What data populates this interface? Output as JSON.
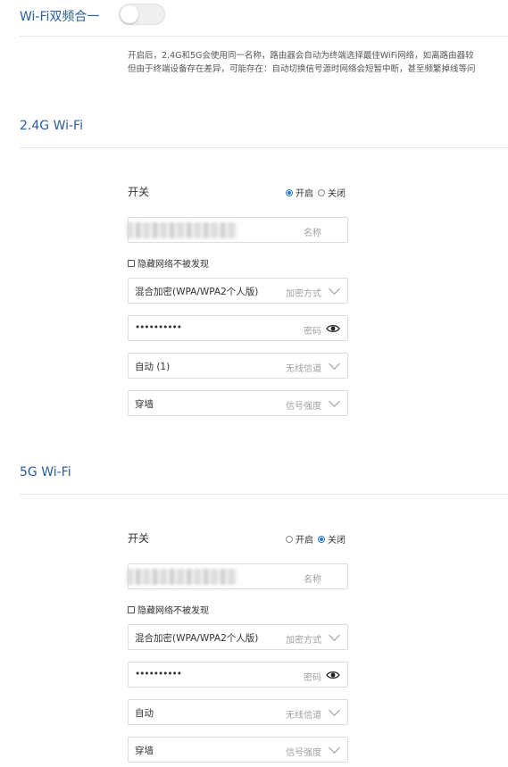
{
  "dual_band": {
    "title": "Wi-Fi双频合一",
    "enabled": false,
    "description_line1": "开启后，2.4G和5G会使用同一名称，路由器会自动为终端选择最佳WiFi网络，如离路由器较",
    "description_line2": "但由于终端设备存在差异，可能存在：自动切换信号源时网络会短暂中断，甚至频繁掉线等问"
  },
  "wifi24": {
    "section_title": "2.4G Wi-Fi",
    "switch_label": "开关",
    "radio_on": "开启",
    "radio_off": "关闭",
    "selected": "on",
    "name_hint": "名称",
    "hide_label": "隐藏网络不被发现",
    "encryption_value": "混合加密(WPA/WPA2个人版)",
    "encryption_hint": "加密方式",
    "password_value": "••••••••••",
    "password_hint": "密码",
    "channel_value": "自动 (1)",
    "channel_hint": "无线信道",
    "strength_value": "穿墙",
    "strength_hint": "信号强度"
  },
  "wifi5": {
    "section_title": "5G Wi-Fi",
    "switch_label": "开关",
    "radio_on": "开启",
    "radio_off": "关闭",
    "selected": "off",
    "name_hint": "名称",
    "hide_label": "隐藏网络不被发现",
    "encryption_value": "混合加密(WPA/WPA2个人版)",
    "encryption_hint": "加密方式",
    "password_value": "••••••••••",
    "password_hint": "密码",
    "channel_value": "自动",
    "channel_hint": "无线信道",
    "strength_value": "穿墙",
    "strength_hint": "信号强度"
  },
  "colors": {
    "title_blue": "#2a5c9e",
    "radio_blue": "#2a7ad5",
    "border": "#dcdcdc"
  },
  "icons": {
    "password_toggle": "eye-icon",
    "dropdown": "chevron-down-icon"
  }
}
